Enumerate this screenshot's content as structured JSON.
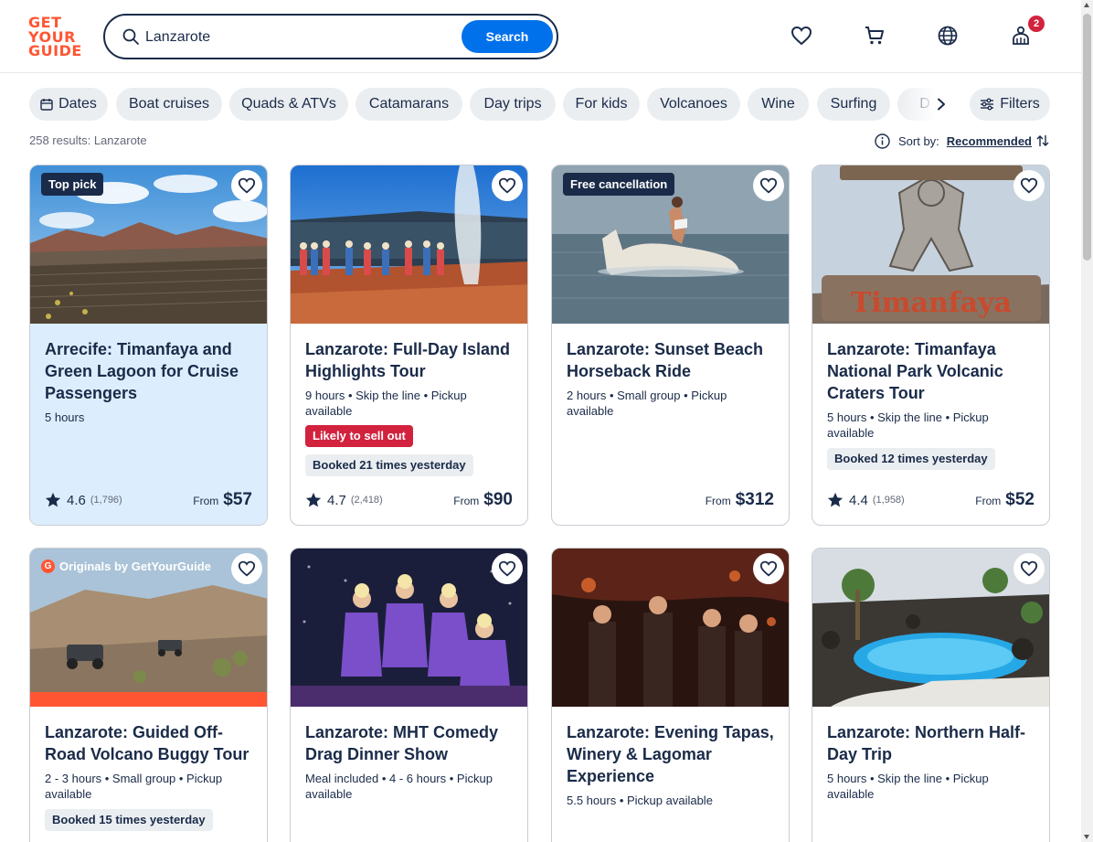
{
  "brand": {
    "logo_lines": [
      "GET",
      "YOUR",
      "GUIDE"
    ],
    "accent": "#ff5533",
    "primary": "#0071eb",
    "navy": "#1a2b49"
  },
  "search": {
    "value": "Lanzarote",
    "button_label": "Search"
  },
  "header": {
    "icons": [
      "heart-icon",
      "cart-icon",
      "globe-icon",
      "profile-icon"
    ],
    "notification_count": "2"
  },
  "chips": {
    "dates_label": "Dates",
    "items": [
      "Boat cruises",
      "Quads & ATVs",
      "Catamarans",
      "Day trips",
      "For kids",
      "Volcanoes",
      "Wine",
      "Surfing",
      "D"
    ],
    "filters_label": "Filters"
  },
  "results": {
    "count_text": "258 results: Lanzarote",
    "sort_label": "Sort by:",
    "sort_value": "Recommended"
  },
  "cards": [
    {
      "badge": "Top pick",
      "title": "Arrecife: Timanfaya and Green Lagoon for Cruise Passengers",
      "meta": "5 hours",
      "rating": "4.6",
      "reviews": "(1,796)",
      "from": "From",
      "price": "$57"
    },
    {
      "title": "Lanzarote: Full-Day Island Highlights Tour",
      "meta": "9 hours • Skip the line • Pickup available",
      "sell_out": "Likely to sell out",
      "booked": "Booked 21 times yesterday",
      "rating": "4.7",
      "reviews": "(2,418)",
      "from": "From",
      "price": "$90"
    },
    {
      "badge": "Free cancellation",
      "title": "Lanzarote: Sunset Beach Horseback Ride",
      "meta": "2 hours • Small group • Pickup available",
      "from": "From",
      "price": "$312"
    },
    {
      "title": "Lanzarote: Timanfaya National Park Volcanic Craters Tour",
      "meta": "5 hours • Skip the line • Pickup available",
      "booked": "Booked 12 times yesterday",
      "rating": "4.4",
      "reviews": "(1,958)",
      "from": "From",
      "price": "$52",
      "sign_text": "Timanfaya"
    },
    {
      "badge": "Originals by GetYourGuide",
      "badge_letter": "G",
      "title": "Lanzarote: Guided Off-Road Volcano Buggy Tour",
      "meta": "2 - 3 hours • Small group • Pickup available",
      "booked": "Booked 15 times yesterday"
    },
    {
      "title": "Lanzarote: MHT Comedy Drag Dinner Show",
      "meta": "Meal included • 4 - 6 hours • Pickup available"
    },
    {
      "title": "Lanzarote: Evening Tapas, Winery & Lagomar Experience",
      "meta": "5.5 hours • Pickup available"
    },
    {
      "title": "Lanzarote: Northern Half-Day Trip",
      "meta": "5 hours • Skip the line • Pickup available"
    }
  ]
}
